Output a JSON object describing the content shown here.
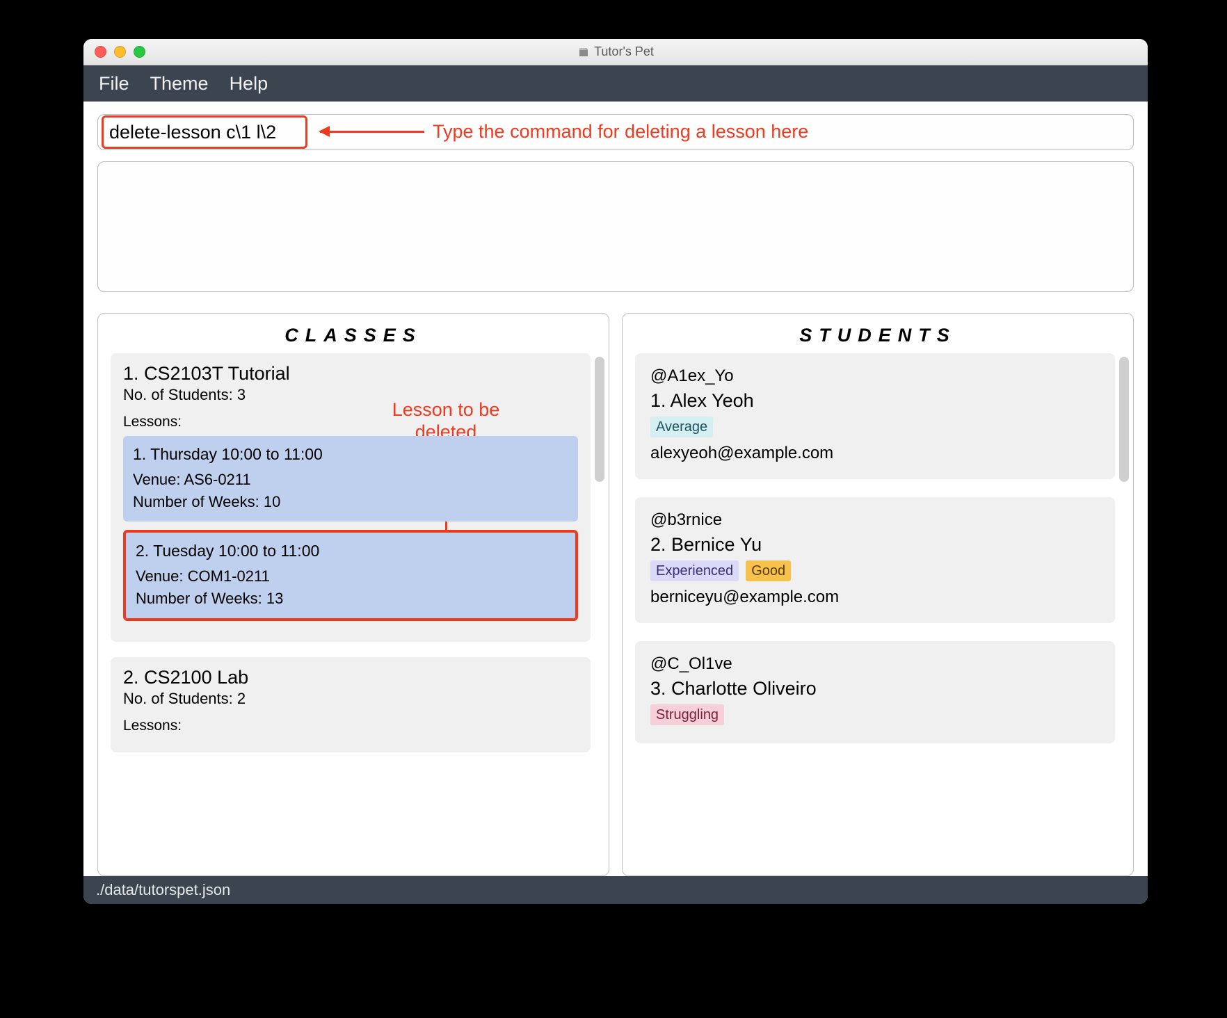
{
  "window": {
    "title": "Tutor's Pet"
  },
  "menu": {
    "items": [
      "File",
      "Theme",
      "Help"
    ]
  },
  "command": {
    "value": "delete-lesson c\\1 l\\2",
    "annotation": "Type the command for deleting a lesson here"
  },
  "lesson_annotation": {
    "line1": "Lesson to be",
    "line2": "deleted"
  },
  "panels": {
    "classes_title": "CLASSES",
    "students_title": "STUDENTS"
  },
  "classes": [
    {
      "index": "1.",
      "name": "CS2103T Tutorial",
      "students_label": "No. of Students:  3",
      "lessons_label": "Lessons:",
      "lessons": [
        {
          "header": "1. Thursday 10:00 to 11:00",
          "venue": "Venue: AS6-0211",
          "weeks": "Number of Weeks: 10",
          "highlighted": false
        },
        {
          "header": "2. Tuesday 10:00 to 11:00",
          "venue": "Venue: COM1-0211",
          "weeks": "Number of Weeks: 13",
          "highlighted": true
        }
      ]
    },
    {
      "index": "2.",
      "name": "CS2100 Lab",
      "students_label": "No. of Students:  2",
      "lessons_label": "Lessons:",
      "lessons": []
    }
  ],
  "students": [
    {
      "handle": "@A1ex_Yo",
      "index": "1.",
      "name": "Alex Yeoh",
      "tags": [
        {
          "text": "Average",
          "cls": "tag-average"
        }
      ],
      "email": "alexyeoh@example.com"
    },
    {
      "handle": "@b3rnice",
      "index": "2.",
      "name": "Bernice Yu",
      "tags": [
        {
          "text": "Experienced",
          "cls": "tag-experienced"
        },
        {
          "text": "Good",
          "cls": "tag-good"
        }
      ],
      "email": "berniceyu@example.com"
    },
    {
      "handle": "@C_Ol1ve",
      "index": "3.",
      "name": "Charlotte Oliveiro",
      "tags": [
        {
          "text": "Struggling",
          "cls": "tag-struggling"
        }
      ],
      "email": ""
    }
  ],
  "status": {
    "path": "./data/tutorspet.json"
  }
}
